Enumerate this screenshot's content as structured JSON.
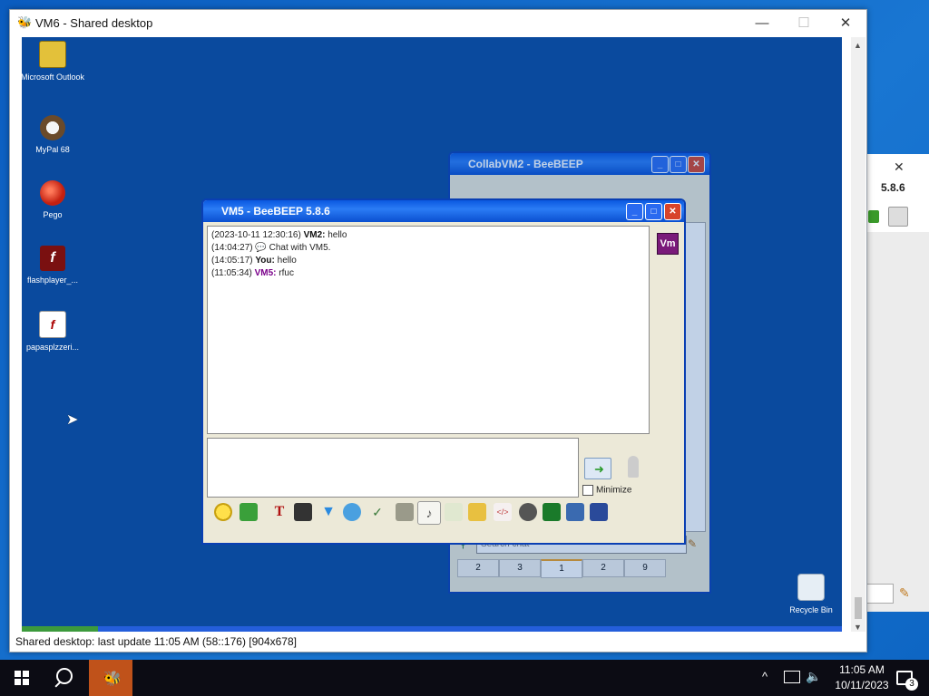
{
  "main_window": {
    "title": "VM6 - Shared desktop",
    "min_label": "—",
    "max_label": "☐",
    "close_label": "✕",
    "status": "Shared desktop: last update 11:05 AM (58::176) [904x678]"
  },
  "bg_window": {
    "close_label": "✕",
    "version": "5.8.6"
  },
  "desktop_icons": [
    {
      "label": "Microsoft Outlook"
    },
    {
      "label": "MyPal 68"
    },
    {
      "label": "Pego"
    },
    {
      "label": "flashplayer_..."
    },
    {
      "label": "papasplzzeri..."
    },
    {
      "label": "Recycle Bin"
    }
  ],
  "collab_window": {
    "title": "CollabVM2 - BeeBEEP",
    "search_placeholder": "Search chat",
    "tabs": [
      {
        "label": "2"
      },
      {
        "label": "3"
      },
      {
        "label": "1"
      },
      {
        "label": "2"
      },
      {
        "label": "9"
      }
    ]
  },
  "bee_window": {
    "title": "VM5 - BeeBEEP 5.8.6",
    "avatar": "Vm",
    "messages": [
      {
        "time": "(2023-10-11 12:30:16)",
        "sender": "VM2:",
        "text": " hello"
      },
      {
        "time": "(14:04:27)",
        "sender": "",
        "text": " Chat with VM5."
      },
      {
        "time": "(14:05:17)",
        "sender": "You:",
        "text": " hello"
      },
      {
        "time": "(11:05:34)",
        "sender": "VM5:",
        "text": " rfuc"
      }
    ],
    "minimize_label": "Minimize",
    "tb_font": "T",
    "tb_note": "♪",
    "tb_code": "</>"
  },
  "taskbar": {
    "time": "11:05 AM",
    "date": "10/11/2023",
    "notifications": "3",
    "chevron": "^"
  }
}
